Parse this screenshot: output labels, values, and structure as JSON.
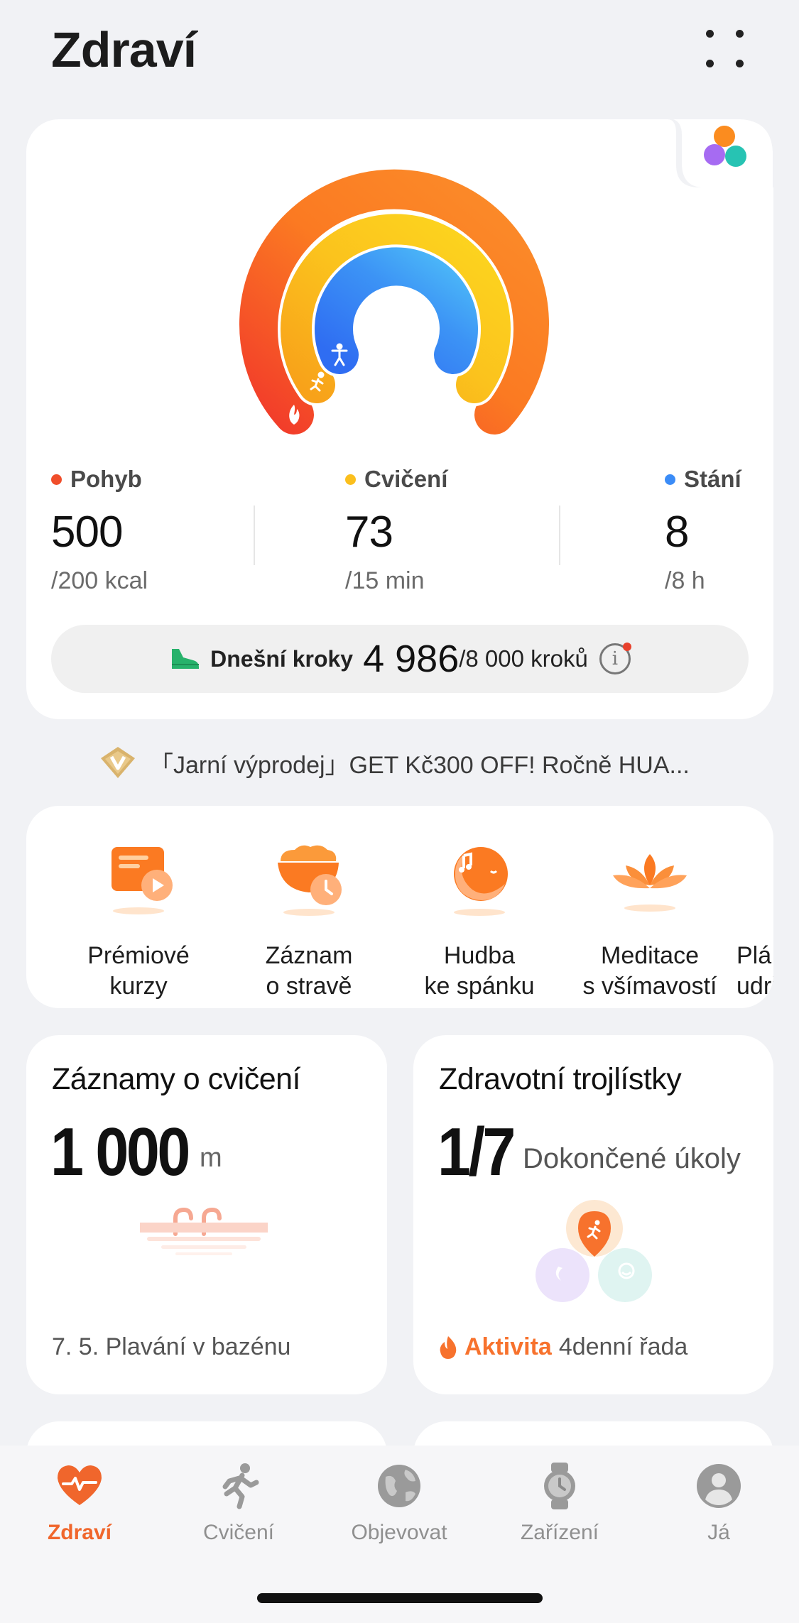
{
  "header": {
    "title": "Zdraví"
  },
  "colors": {
    "accent": "#f0662c",
    "move": "#f04e2b",
    "exercise": "#fbbf1d",
    "stand": "#3b8cf7"
  },
  "metrics": [
    {
      "label": "Pohyb",
      "value": "500",
      "goal": "/200 kcal"
    },
    {
      "label": "Cvičení",
      "value": "73",
      "goal": "/15 min"
    },
    {
      "label": "Stání",
      "value": "8",
      "goal": "/8 h"
    }
  ],
  "steps": {
    "label": "Dnešní kroky",
    "value": "4 986",
    "goal": "/8 000 kroků",
    "info": "i"
  },
  "promo": {
    "text": "「Jarní výprodej」GET Kč300 OFF!  Ročně HUA..."
  },
  "services": [
    {
      "line1": "Prémiové",
      "line2": "kurzy",
      "icon": "premium-course-icon"
    },
    {
      "line1": "Záznam",
      "line2": "o stravě",
      "icon": "diet-log-icon"
    },
    {
      "line1": "Hudba",
      "line2": "ke spánku",
      "icon": "sleep-music-icon"
    },
    {
      "line1": "Meditace",
      "line2": "s všímavostí",
      "icon": "lotus-icon"
    },
    {
      "line1": "Plá",
      "line2": "udrž",
      "icon": "plan-icon"
    }
  ],
  "exercise_card": {
    "title": "Záznamy o cvičení",
    "value": "1 000",
    "unit": "m",
    "footer": "7. 5. Plavání v bazénu"
  },
  "trefoil_card": {
    "title": "Zdravotní trojlístky",
    "value": "1/7",
    "subtitle": "Dokončené úkoly",
    "footer_accent": "Aktivita",
    "footer_text": "4denní řada"
  },
  "tabs": [
    {
      "label": "Zdraví",
      "icon": "heart-pulse-icon",
      "active": true
    },
    {
      "label": "Cvičení",
      "icon": "runner-icon",
      "active": false
    },
    {
      "label": "Objevovat",
      "icon": "globe-icon",
      "active": false
    },
    {
      "label": "Zařízení",
      "icon": "watch-icon",
      "active": false
    },
    {
      "label": "Já",
      "icon": "profile-icon",
      "active": false
    }
  ]
}
